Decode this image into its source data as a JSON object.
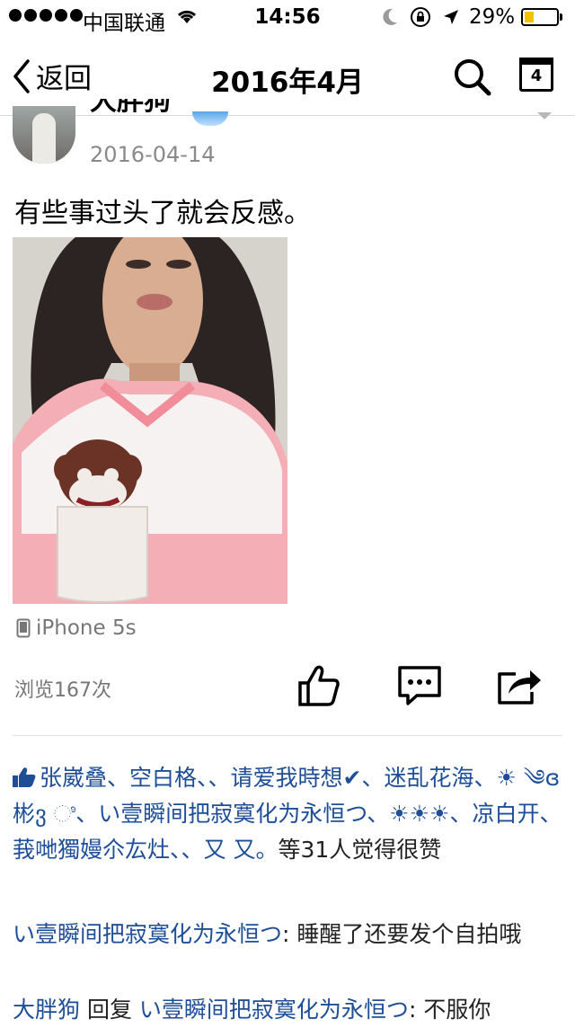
{
  "status_bar": {
    "carrier": "中国联通",
    "time": "14:56",
    "battery": "29%",
    "battery_level": 0.29
  },
  "nav": {
    "back_label": "返回",
    "title": "2016年4月",
    "calendar_day": "4"
  },
  "post": {
    "username": "大胖狗",
    "date": "2016-04-14",
    "text": "有些事过头了就会反感。",
    "device": "iPhone 5s",
    "views": "浏览167次"
  },
  "likes": {
    "names": "张崴叠、空白格、、请爱我時想✔、迷乱花海、☀ ༄ɞ 彬ვ ಿ、い壹瞬间把寂寞化为永恒つ、☀☀☀、凉白开、莪哋獨嫚尒厷灶、、又 又。",
    "summary": "等31人觉得很赞"
  },
  "comments": [
    {
      "author": "い壹瞬间把寂寞化为永恒つ",
      "sep": ": ",
      "text": "睡醒了还要发个自拍哦"
    },
    {
      "author": "大胖狗",
      "reply_word": " 回复 ",
      "reply_to": "い壹瞬间把寂寞化为永恒つ",
      "sep": ": ",
      "text": "不服你"
    }
  ],
  "colors": {
    "link_blue": "#1e4e97",
    "battery_yellow": "#f2c200",
    "meta_gray": "#8a8a8a"
  }
}
